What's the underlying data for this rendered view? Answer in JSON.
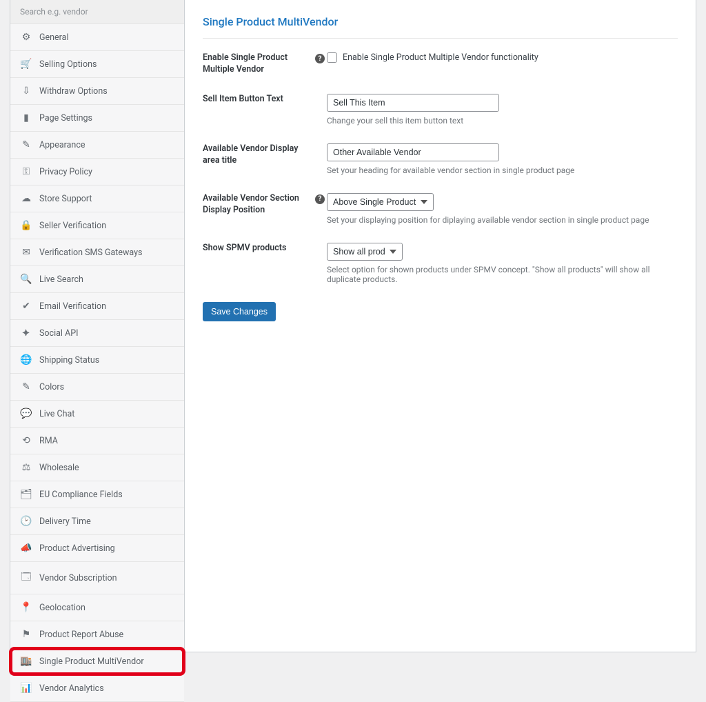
{
  "sidebar": {
    "search_placeholder": "Search e.g. vendor",
    "items": [
      {
        "label": "General",
        "icon": "gear-icon",
        "icon_glyph": "⚙",
        "icon_class": "ic-blue"
      },
      {
        "label": "Selling Options",
        "icon": "cart-icon",
        "icon_glyph": "🛒",
        "icon_class": "ic-teal"
      },
      {
        "label": "Withdraw Options",
        "icon": "withdraw-icon",
        "icon_glyph": "⇩",
        "icon_class": "ic-orange"
      },
      {
        "label": "Page Settings",
        "icon": "page-icon",
        "icon_glyph": "▮",
        "icon_class": "ic-purple"
      },
      {
        "label": "Appearance",
        "icon": "brush-icon",
        "icon_glyph": "✎",
        "icon_class": "ic-lblue"
      },
      {
        "label": "Privacy Policy",
        "icon": "key-icon",
        "icon_glyph": "⚿",
        "icon_class": "ic-gray"
      },
      {
        "label": "Store Support",
        "icon": "chat-icon",
        "icon_glyph": "☁",
        "icon_class": "ic-gray"
      },
      {
        "label": "Seller Verification",
        "icon": "lock-icon",
        "icon_glyph": "🔒",
        "icon_class": "ic-gray"
      },
      {
        "label": "Verification SMS Gateways",
        "icon": "mail-icon",
        "icon_glyph": "✉",
        "icon_class": "ic-gray"
      },
      {
        "label": "Live Search",
        "icon": "search-icon",
        "icon_glyph": "🔍",
        "icon_class": "ic-gray"
      },
      {
        "label": "Email Verification",
        "icon": "shield-check-icon",
        "icon_glyph": "✔",
        "icon_class": "ic-gray"
      },
      {
        "label": "Social API",
        "icon": "share-icon",
        "icon_glyph": "⯌",
        "icon_class": "ic-green"
      },
      {
        "label": "Shipping Status",
        "icon": "globe-icon",
        "icon_glyph": "🌐",
        "icon_class": "ic-gray"
      },
      {
        "label": "Colors",
        "icon": "paint-icon",
        "icon_glyph": "✎",
        "icon_class": "ic-gray"
      },
      {
        "label": "Live Chat",
        "icon": "livechat-icon",
        "icon_glyph": "💬",
        "icon_class": "ic-gray"
      },
      {
        "label": "RMA",
        "icon": "refresh-icon",
        "icon_glyph": "⟲",
        "icon_class": "ic-gray"
      },
      {
        "label": "Wholesale",
        "icon": "wholesale-icon",
        "icon_glyph": "⚖",
        "icon_class": "ic-gray"
      },
      {
        "label": "EU Compliance Fields",
        "icon": "id-icon",
        "icon_glyph": "🗂",
        "icon_class": "ic-gray"
      },
      {
        "label": "Delivery Time",
        "icon": "clock-icon",
        "icon_glyph": "🕑",
        "icon_class": "ic-gray"
      },
      {
        "label": "Product Advertising",
        "icon": "megaphone-icon",
        "icon_glyph": "📣",
        "icon_class": "ic-gray"
      },
      {
        "label": "Vendor Subscription",
        "icon": "subscription-icon",
        "icon_glyph": "🗔",
        "icon_class": "ic-gray"
      },
      {
        "label": "Geolocation",
        "icon": "pin-icon",
        "icon_glyph": "📍",
        "icon_class": "ic-gray"
      },
      {
        "label": "Product Report Abuse",
        "icon": "flag-icon",
        "icon_glyph": "⚑",
        "icon_class": "ic-gray"
      },
      {
        "label": "Single Product MultiVendor",
        "icon": "store-icon",
        "icon_glyph": "🏬",
        "icon_class": "ic-gray",
        "highlight": true
      },
      {
        "label": "Vendor Analytics",
        "icon": "chart-icon",
        "icon_glyph": "📊",
        "icon_class": "ic-gray"
      }
    ]
  },
  "main": {
    "title": "Single Product MultiVendor",
    "row_enable": {
      "label": "Enable Single Product Multiple Vendor",
      "checkbox_label": "Enable Single Product Multiple Vendor functionality"
    },
    "row_button_text": {
      "label": "Sell Item Button Text",
      "value": "Sell This Item",
      "desc": "Change your sell this item button text"
    },
    "row_area_title": {
      "label": "Available Vendor Display area title",
      "value": "Other Available Vendor",
      "desc": "Set your heading for available vendor section in single product page"
    },
    "row_position": {
      "label": "Available Vendor Section Display Position",
      "value": "Above Single Product Tabs",
      "desc": "Set your displaying position for diplaying available vendor section in single product page"
    },
    "row_spmv": {
      "label": "Show SPMV products",
      "value": "Show all products",
      "desc": "Select option for shown products under SPMV concept. \"Show all products\" will show all duplicate products."
    },
    "save_label": "Save Changes"
  }
}
